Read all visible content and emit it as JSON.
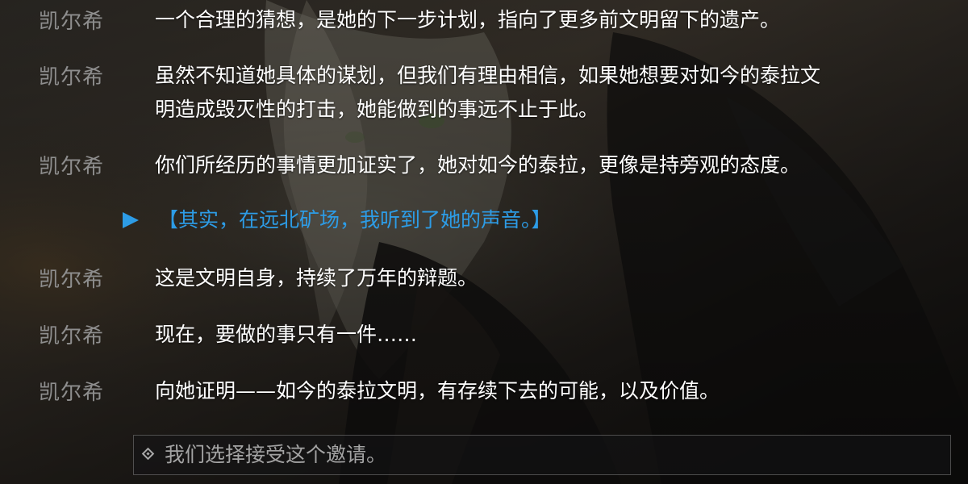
{
  "dialogue_log": [
    {
      "speaker": "凯尔希",
      "text": "一个合理的猜想，是她的下一步计划，指向了更多前文明留下的遗产。"
    },
    {
      "speaker": "凯尔希",
      "text": "虽然不知道她具体的谋划，但我们有理由相信，如果她想要对如今的泰拉文\n明造成毁灭性的打击，她能做到的事远不止于此。"
    },
    {
      "speaker": "凯尔希",
      "text": "你们所经历的事情更加证实了，她对如今的泰拉，更像是持旁观的态度。"
    },
    {
      "choice": "【其实，在远北矿场，我听到了她的声音。】"
    },
    {
      "speaker": "凯尔希",
      "text": "这是文明自身，持续了万年的辩题。"
    },
    {
      "speaker": "凯尔希",
      "text": "现在，要做的事只有一件……"
    },
    {
      "speaker": "凯尔希",
      "text": "向她证明——如今的泰拉文明，有存续下去的可能，以及价值。"
    }
  ],
  "option": {
    "icon": "diamond-icon",
    "label": "我们选择接受这个邀请。"
  },
  "colors": {
    "speaker": "#8e8e8e",
    "dialogue": "#ffffff",
    "choice": "#2d9ce6",
    "option_text": "#a3a3a3"
  }
}
